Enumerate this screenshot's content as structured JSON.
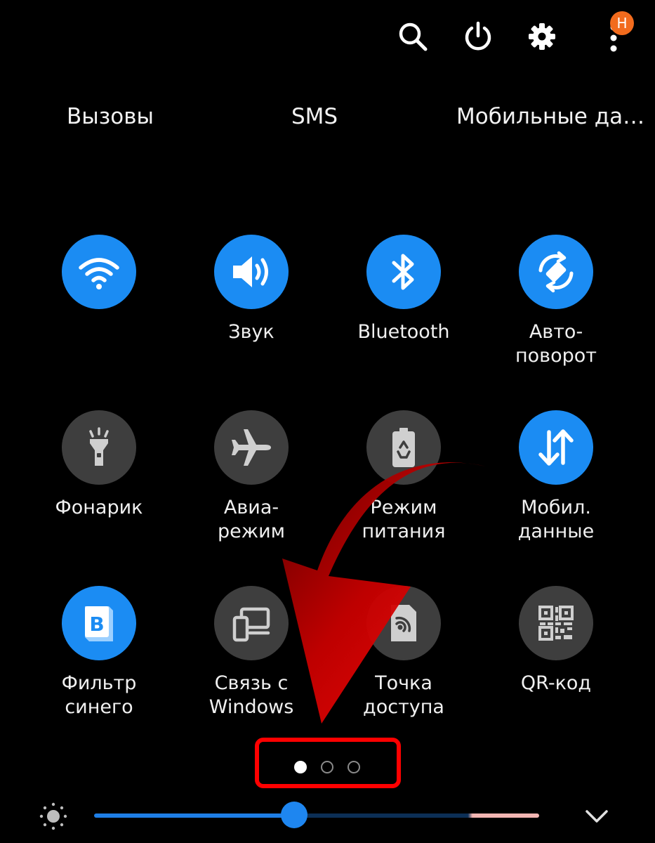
{
  "header": {
    "notification_badge": "Н",
    "icons": [
      "search-icon",
      "power-icon",
      "gear-icon",
      "more-vertical-icon"
    ]
  },
  "sim_tabs": [
    {
      "label": "Вызовы"
    },
    {
      "label": "SMS"
    },
    {
      "label": "Мобильные да…"
    }
  ],
  "tiles": [
    {
      "icon": "wifi-icon",
      "line1": "",
      "line2": "",
      "state": "on"
    },
    {
      "icon": "sound-icon",
      "line1": "Звук",
      "line2": "",
      "state": "on"
    },
    {
      "icon": "bluetooth-icon",
      "line1": "Bluetooth",
      "line2": "",
      "state": "on"
    },
    {
      "icon": "auto-rotate-icon",
      "line1": "Авто-",
      "line2": "поворот",
      "state": "on"
    },
    {
      "icon": "flashlight-icon",
      "line1": "Фонарик",
      "line2": "",
      "state": "off"
    },
    {
      "icon": "airplane-icon",
      "line1": "Авиа-",
      "line2": "режим",
      "state": "off"
    },
    {
      "icon": "power-saving-icon",
      "line1": "Режим",
      "line2": "питания",
      "state": "off"
    },
    {
      "icon": "mobile-data-icon",
      "line1": "Мобил.",
      "line2": "данные",
      "state": "on"
    },
    {
      "icon": "blue-light-filter-icon",
      "line1": "Фильтр",
      "line2": "синего",
      "state": "on"
    },
    {
      "icon": "link-to-windows-icon",
      "line1": "Связь с",
      "line2": "Windows",
      "state": "off"
    },
    {
      "icon": "hotspot-icon",
      "line1": "Точка",
      "line2": "доступа",
      "state": "off"
    },
    {
      "icon": "qr-code-icon",
      "line1": "QR-код",
      "line2": "",
      "state": "off"
    }
  ],
  "pagination": {
    "pages": 3,
    "current": 1
  },
  "brightness": {
    "level_percent": 45,
    "icon": "brightness-icon"
  },
  "expand": {
    "icon": "chevron-down-icon"
  },
  "colors": {
    "tile_on": "#1b8cf3",
    "tile_off": "#3e3e3e",
    "accent": "#1e86f0",
    "badge": "#f26b1d",
    "annotation": "#ff0000"
  }
}
